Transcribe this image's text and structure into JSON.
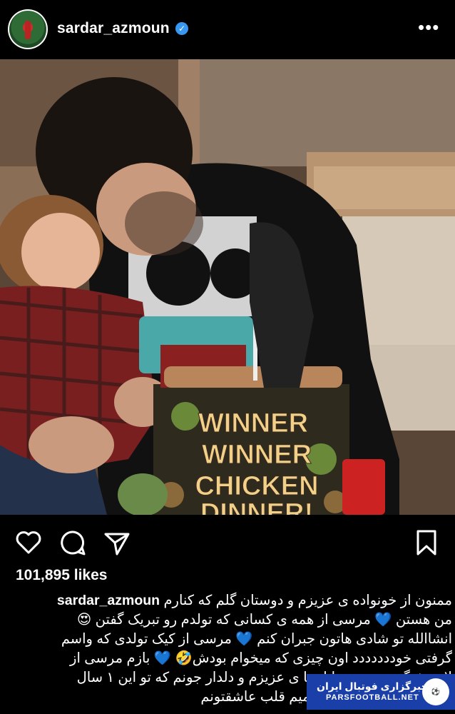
{
  "header": {
    "username": "sardar_azmoun",
    "verified_icon": "verified-badge-icon",
    "more_icon": "more-options-icon",
    "more_label": "•••"
  },
  "post": {
    "cake_text_1": "WINNER",
    "cake_text_2": "WINNER",
    "cake_text_3": "CHICKEN",
    "cake_text_4": "DINNER!"
  },
  "actions": {
    "like_icon": "heart-icon",
    "comment_icon": "comment-icon",
    "share_icon": "share-icon",
    "save_icon": "bookmark-icon"
  },
  "likes": "101,895 likes",
  "caption": {
    "username": "sardar_azmoun",
    "line1": "ممنون از خونواده ی عزیزم و دوستان گلم که کنارم",
    "line2": "من هستن 💙 مرسی از همه ی کسانی که تولدم رو تبریک گفتن 😍",
    "line3": "انشاالله تو شادی هاتون جبران کنم 💙 مرسی از کیک تولدی که واسم",
    "line4": "گرفتی خوددددددد اون چیزی که میخوام بودش🤣 💙 بازم مرسی از",
    "line5": "لاریقشنگ همسرم و اناهیتا ی عزیزم و دلدار جونم که تو این ۱ سال",
    "line6": "💙تنهام نزاشتن 💙 از صمیم قلب عاشقتونم"
  },
  "watermark": {
    "title": "خبرگزاری فوتبال ایران",
    "site": "PARSFOOTBALL.NET"
  },
  "colors": {
    "background": "#000000",
    "text": "#ffffff",
    "verified": "#3897f0",
    "watermark_bg": "#1a3fa8"
  }
}
